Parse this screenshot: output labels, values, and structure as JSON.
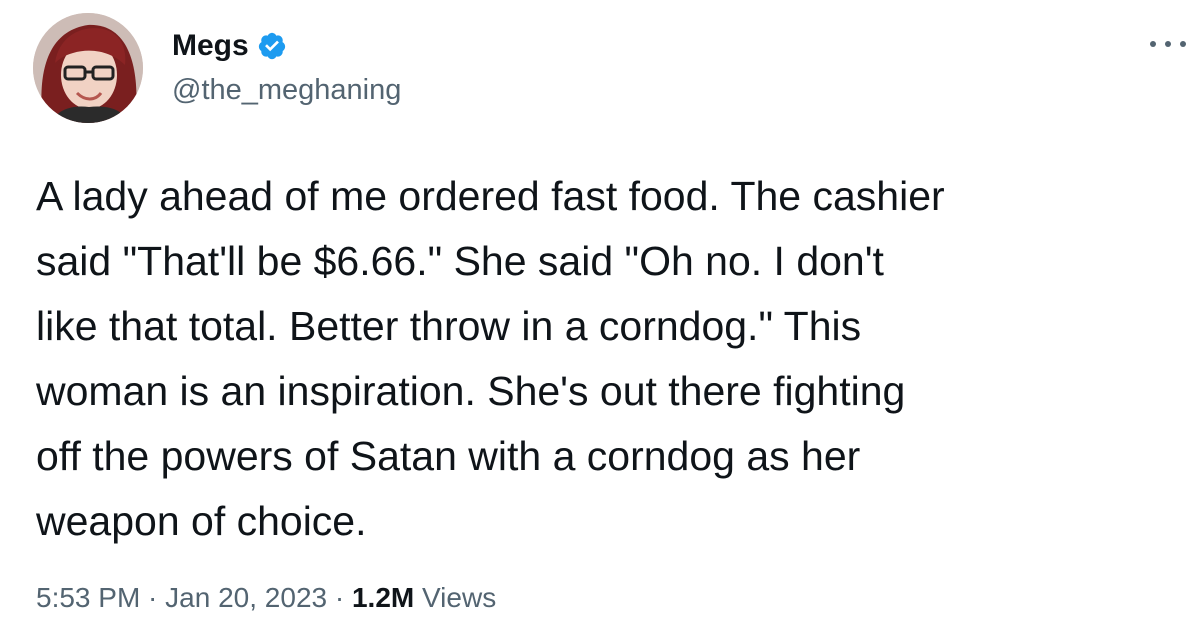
{
  "author": {
    "display_name": "Megs",
    "handle": "@the_meghaning",
    "verified": true,
    "avatar_icon": "profile-photo",
    "verified_icon": "verified-badge-icon",
    "verified_color": "#1d9bf0"
  },
  "menu": {
    "icon": "more-options-icon"
  },
  "tweet": {
    "text": "A lady ahead of me ordered fast food. The cashier\nsaid \"That'll be $6.66.\" She said \"Oh no. I don't\nlike that total. Better throw in a corndog.\" This\nwoman is an inspiration. She's out there fighting\noff the powers of Satan with a corndog as her\nweapon of choice."
  },
  "meta": {
    "time": "5:53 PM",
    "separator": " · ",
    "date": "Jan 20, 2023",
    "views_count": "1.2M",
    "views_label": " Views"
  },
  "colors": {
    "text": "#0f1419",
    "secondary": "#536471",
    "accent": "#1d9bf0",
    "background": "#ffffff"
  }
}
